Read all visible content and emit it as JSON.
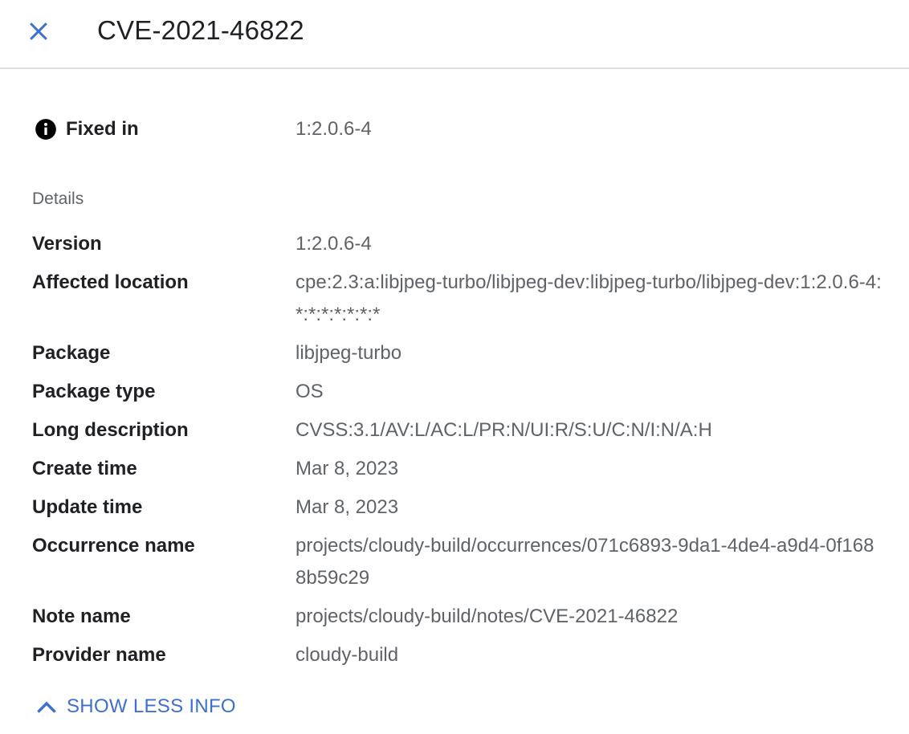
{
  "header": {
    "title": "CVE-2021-46822"
  },
  "fixed_in": {
    "label": "Fixed in",
    "value": "1:2.0.6-4"
  },
  "details": {
    "section_label": "Details",
    "rows": [
      {
        "key": "Version",
        "value": "1:2.0.6-4"
      },
      {
        "key": "Affected location",
        "value": "cpe:2.3:a:libjpeg-turbo/libjpeg-dev:libjpeg-turbo/libjpeg-dev:1:2.0.6-4:*:*:*:*:*:*:*"
      },
      {
        "key": "Package",
        "value": "libjpeg-turbo"
      },
      {
        "key": "Package type",
        "value": "OS"
      },
      {
        "key": "Long description",
        "value": "CVSS:3.1/AV:L/AC:L/PR:N/UI:R/S:U/C:N/I:N/A:H"
      },
      {
        "key": "Create time",
        "value": "Mar 8, 2023"
      },
      {
        "key": "Update time",
        "value": "Mar 8, 2023"
      },
      {
        "key": "Occurrence name",
        "value": "projects/cloudy-build/occurrences/071c6893-9da1-4de4-a9d4-0f1688b59c29"
      },
      {
        "key": "Note name",
        "value": "projects/cloudy-build/notes/CVE-2021-46822"
      },
      {
        "key": "Provider name",
        "value": "cloudy-build"
      }
    ]
  },
  "toggle": {
    "label": "SHOW LESS INFO",
    "icon": "chevron-up-icon"
  },
  "colors": {
    "accent": "#3c6fd0",
    "text_primary": "#202124",
    "text_secondary": "#5f6368",
    "divider": "#e0e0e0"
  }
}
